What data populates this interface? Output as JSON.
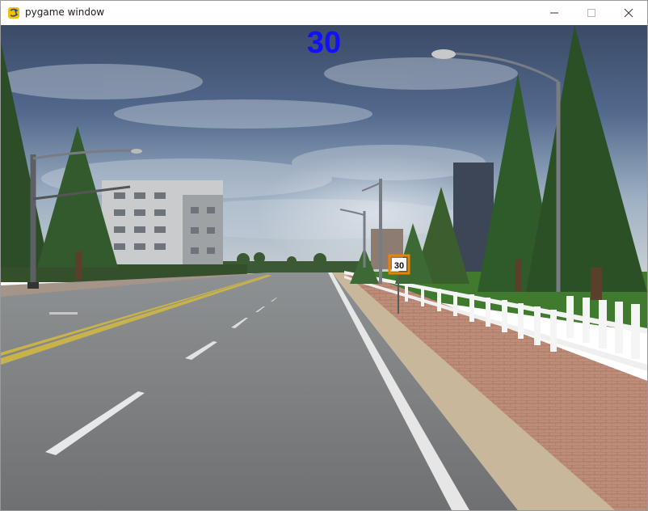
{
  "window": {
    "title": "pygame window",
    "icon": "pygame-snake-icon",
    "controls": {
      "minimize_icon": "minimize-icon",
      "maximize_icon": "maximize-icon",
      "close_icon": "close-icon"
    }
  },
  "hud": {
    "speed": "30",
    "speed_color": "#1010ff"
  },
  "scene": {
    "speed_sign": {
      "text": "30",
      "highlight_color": "#f08000"
    }
  }
}
